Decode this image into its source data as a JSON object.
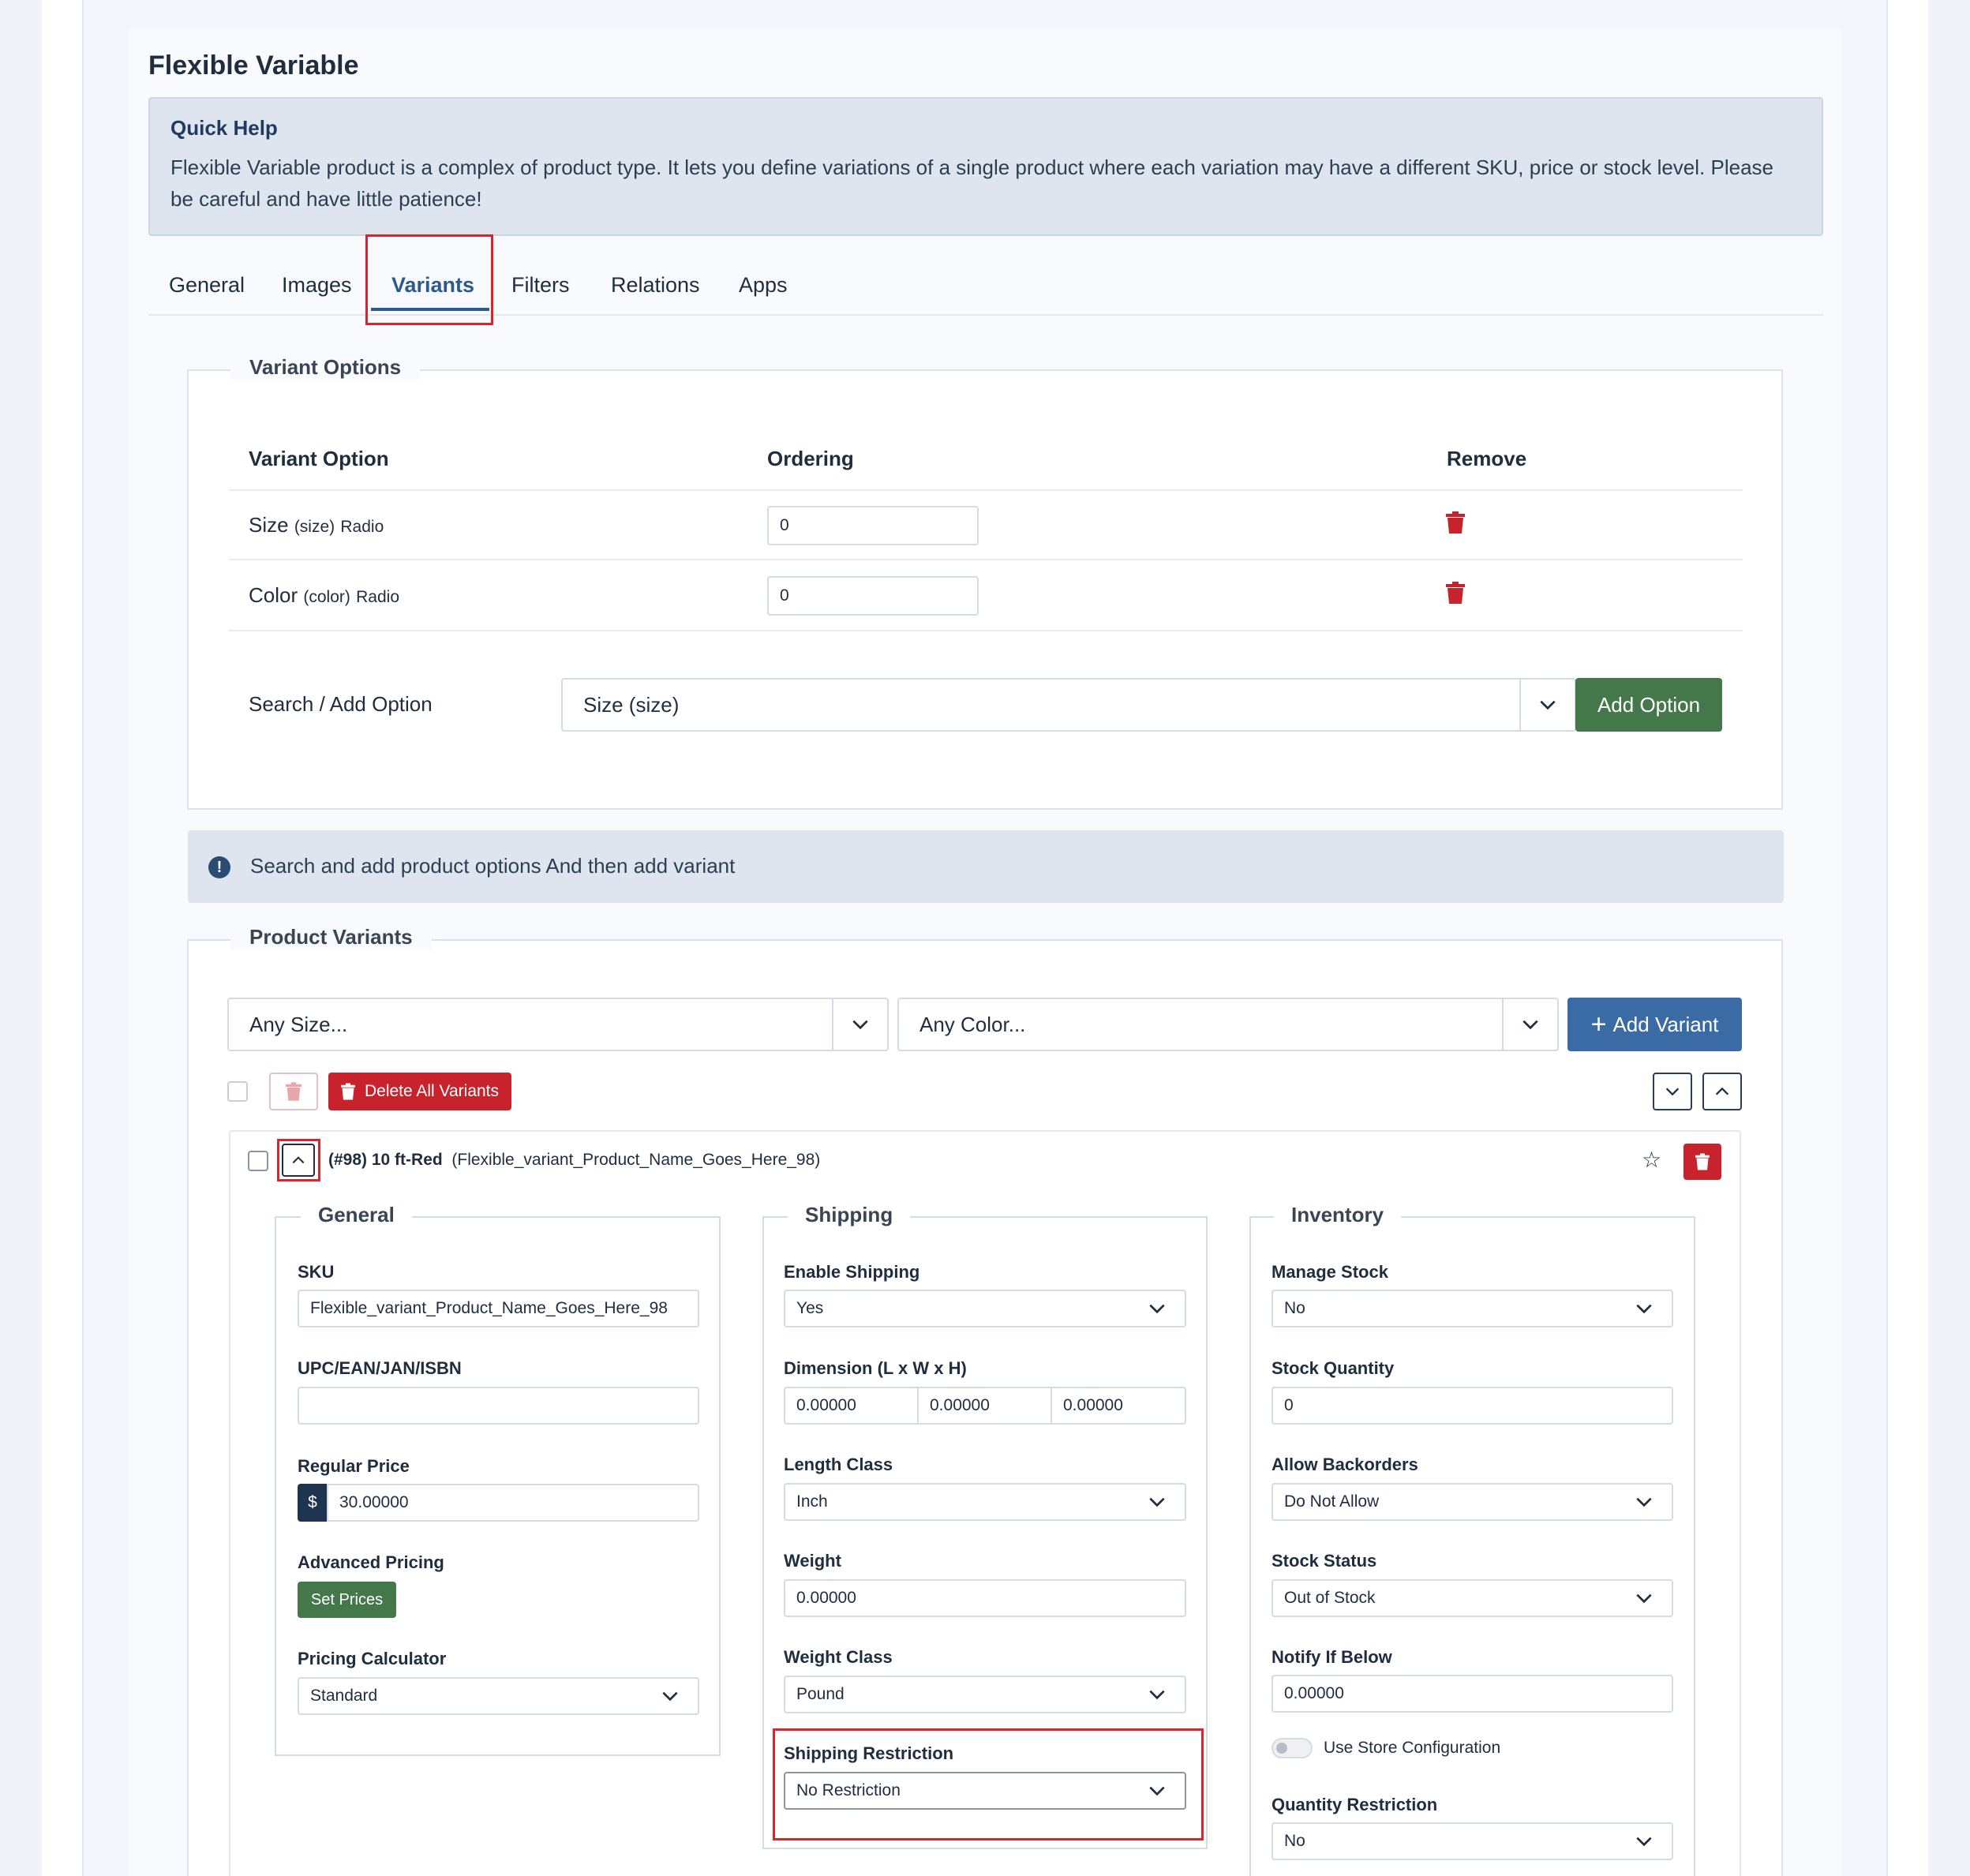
{
  "page": {
    "title": "Flexible Variable"
  },
  "quick_help": {
    "title": "Quick Help",
    "text": "Flexible Variable product is a complex of product type. It lets you define variations of a single product where each variation may have a different SKU, price or stock level. Please be careful and have little patience!"
  },
  "tabs": [
    {
      "label": "General"
    },
    {
      "label": "Images"
    },
    {
      "label": "Variants",
      "active": true
    },
    {
      "label": "Filters"
    },
    {
      "label": "Relations"
    },
    {
      "label": "Apps"
    }
  ],
  "variant_options": {
    "legend": "Variant Options",
    "headers": {
      "option": "Variant Option",
      "ordering": "Ordering",
      "remove": "Remove"
    },
    "rows": [
      {
        "name": "Size",
        "code": "(size)",
        "type": "Radio",
        "ordering": "0"
      },
      {
        "name": "Color",
        "code": "(color)",
        "type": "Radio",
        "ordering": "0"
      }
    ],
    "search_label": "Search / Add Option",
    "search_value": "Size (size)",
    "add_button": "Add Option"
  },
  "info_message": "Search and add product options And then add variant",
  "product_variants": {
    "legend": "Product Variants",
    "size_filter": "Any Size...",
    "color_filter": "Any Color...",
    "add_variant_button": "Add Variant",
    "delete_all_button": "Delete All Variants",
    "variant": {
      "id": "(#98) 10 ft-Red",
      "name": "(Flexible_variant_Product_Name_Goes_Here_98)",
      "general": {
        "legend": "General",
        "sku_label": "SKU",
        "sku_value": "Flexible_variant_Product_Name_Goes_Here_98",
        "upc_label": "UPC/EAN/JAN/ISBN",
        "upc_value": "",
        "price_label": "Regular Price",
        "currency": "$",
        "price_value": "30.00000",
        "advanced_label": "Advanced Pricing",
        "set_prices": "Set Prices",
        "calc_label": "Pricing Calculator",
        "calc_value": "Standard"
      },
      "shipping": {
        "legend": "Shipping",
        "enable_label": "Enable Shipping",
        "enable_value": "Yes",
        "dimension_label": "Dimension (L x W x H)",
        "dim_l": "0.00000",
        "dim_w": "0.00000",
        "dim_h": "0.00000",
        "length_class_label": "Length Class",
        "length_class_value": "Inch",
        "weight_label": "Weight",
        "weight_value": "0.00000",
        "weight_class_label": "Weight Class",
        "weight_class_value": "Pound",
        "restriction_label": "Shipping Restriction",
        "restriction_value": "No Restriction"
      },
      "inventory": {
        "legend": "Inventory",
        "manage_label": "Manage Stock",
        "manage_value": "No",
        "qty_label": "Stock Quantity",
        "qty_value": "0",
        "backorders_label": "Allow Backorders",
        "backorders_value": "Do Not Allow",
        "status_label": "Stock Status",
        "status_value": "Out of Stock",
        "notify_label": "Notify If Below",
        "notify_value": "0.00000",
        "store_config_label": "Use Store Configuration",
        "qty_restriction_label": "Quantity Restriction",
        "qty_restriction_value": "No"
      }
    }
  },
  "colors": {
    "primary": "#3a6ba5",
    "success": "#44784a",
    "danger": "#c8232c",
    "highlight": "#d9262c"
  }
}
